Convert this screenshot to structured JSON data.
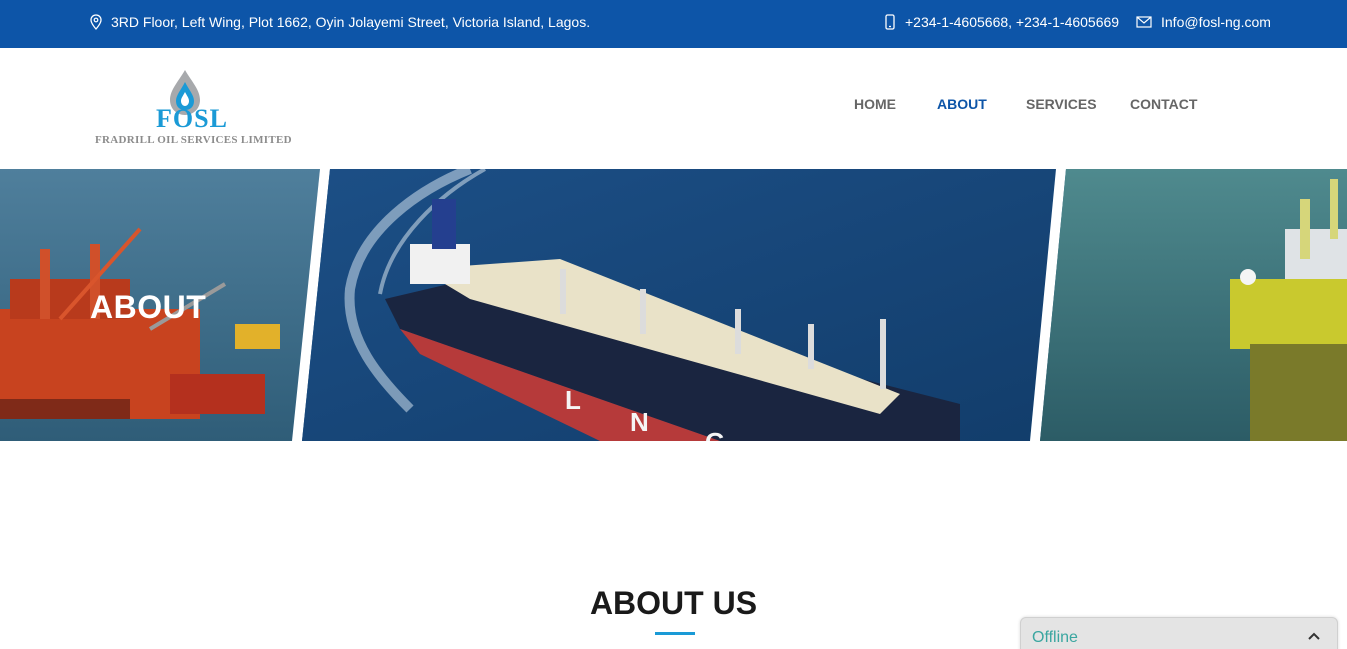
{
  "topbar": {
    "address": "3RD Floor, Left Wing, Plot 1662, Oyin Jolayemi Street, Victoria Island, Lagos.",
    "phone": "+234-1-4605668, +234-1-4605669",
    "email": "Info@fosl-ng.com",
    "icons": {
      "address": "map-pin-icon",
      "phone": "mobile-phone-icon",
      "email": "envelope-icon"
    }
  },
  "logo": {
    "mark": "FOSL",
    "company": "FRADRILL OIL SERVICES LIMITED"
  },
  "nav": {
    "items": [
      {
        "label": "HOME",
        "active": false
      },
      {
        "label": "ABOUT",
        "active": true
      },
      {
        "label": "SERVICES",
        "active": false
      },
      {
        "label": "CONTACT",
        "active": false
      }
    ]
  },
  "hero": {
    "title": "ABOUT"
  },
  "about": {
    "heading": "ABOUT US"
  },
  "chat_widget": {
    "status": "Offline",
    "icon": "chevron-up-icon"
  },
  "colors": {
    "brand_blue": "#0d55a8",
    "accent_cyan": "#1a9ad6",
    "nav_text": "#666666",
    "chat_status": "#3aa6a0"
  }
}
